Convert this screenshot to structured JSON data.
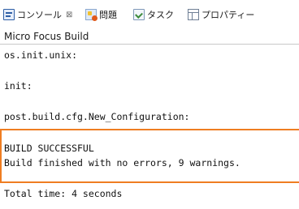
{
  "tabs": [
    {
      "label": "コンソール",
      "icon": "console-icon",
      "closable": true
    },
    {
      "label": "問題",
      "icon": "problems-icon"
    },
    {
      "label": "タスク",
      "icon": "tasks-icon"
    },
    {
      "label": "プロパティー",
      "icon": "properties-icon"
    }
  ],
  "console": {
    "title": "Micro Focus Build",
    "lines": [
      "os.init.unix:",
      "init:",
      "post.build.cfg.New_Configuration:",
      "BUILD SUCCESSFUL",
      "Build finished with no errors, 9 warnings.",
      "Total time: 4 seconds"
    ]
  },
  "colors": {
    "highlight_border": "#ef7d22",
    "console_icon": "#2f5fa6"
  }
}
